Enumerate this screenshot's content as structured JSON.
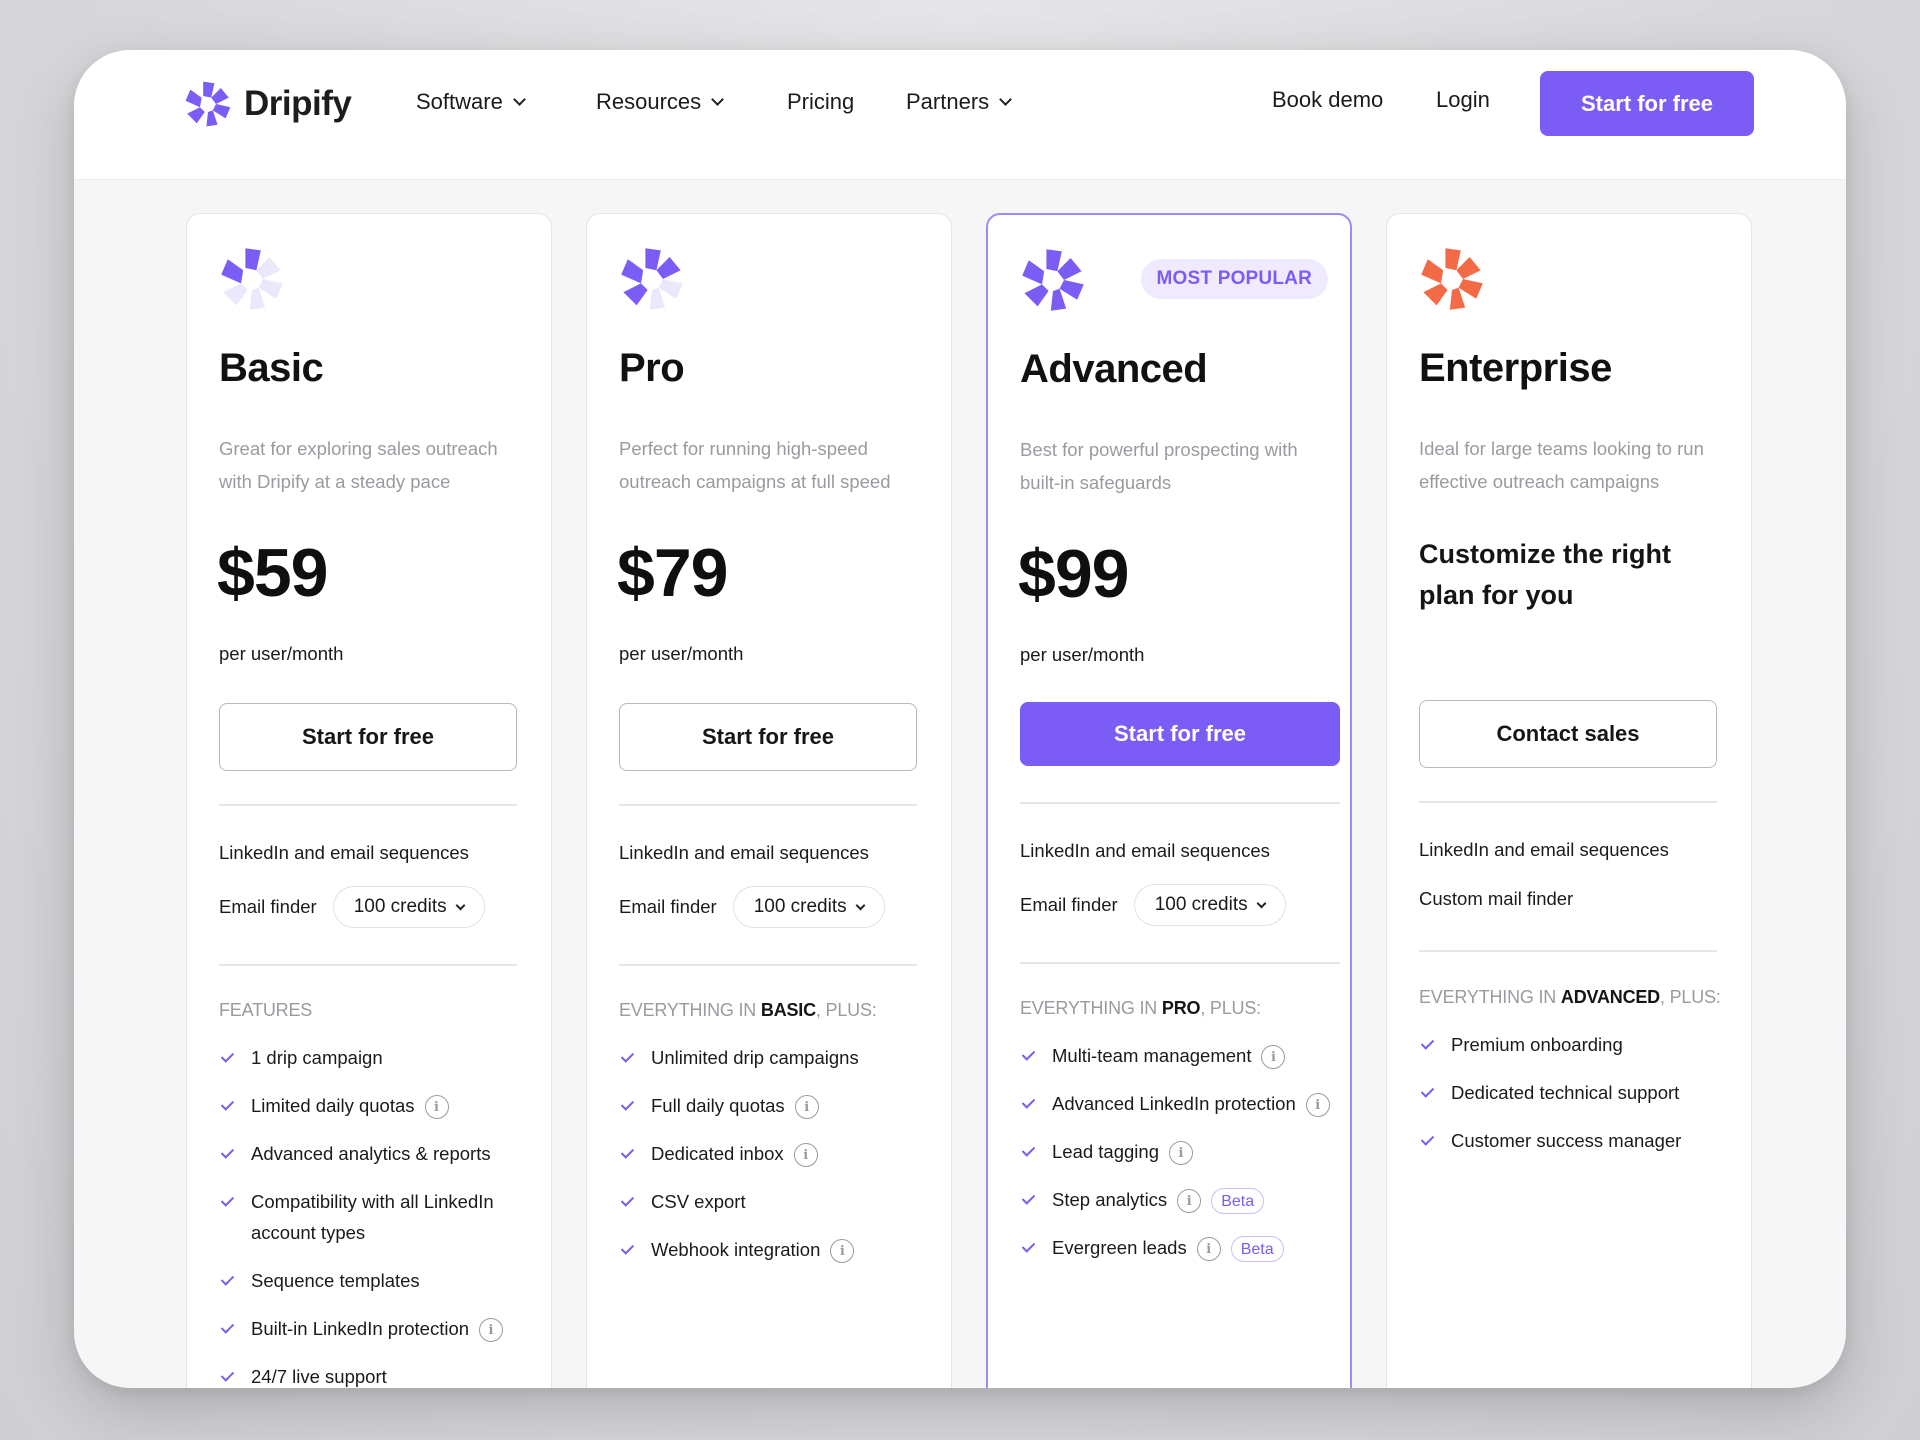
{
  "brand": {
    "name": "Dripify",
    "accent": "#7b5cf5",
    "enterprise_accent": "#f26a46"
  },
  "nav": {
    "software": "Software",
    "resources": "Resources",
    "pricing": "Pricing",
    "partners": "Partners",
    "book_demo": "Book demo",
    "login": "Login",
    "cta": "Start for free"
  },
  "plans": [
    {
      "name": "Basic",
      "desc": "Great for exploring sales outreach with Dripify at a steady pace",
      "price": "$59",
      "per": "per user/month",
      "button": "Start for free",
      "line1": "LinkedIn and email sequences",
      "finder_label": "Email finder",
      "credits": "100 credits",
      "section": {
        "prefix": "FEATURES",
        "bold": "",
        "suffix": ""
      },
      "features": [
        {
          "text": "1 drip campaign",
          "info": false
        },
        {
          "text": "Limited daily quotas",
          "info": true
        },
        {
          "text": "Advanced analytics & reports",
          "info": false
        },
        {
          "text": "Compatibility with all LinkedIn account types",
          "info": false
        },
        {
          "text": "Sequence templates",
          "info": false
        },
        {
          "text": "Built-in LinkedIn protection",
          "info": true
        },
        {
          "text": "24/7 live support",
          "info": false
        }
      ]
    },
    {
      "name": "Pro",
      "desc": "Perfect for running high-speed outreach campaigns at full speed",
      "price": "$79",
      "per": "per user/month",
      "button": "Start for free",
      "line1": "LinkedIn and email sequences",
      "finder_label": "Email finder",
      "credits": "100 credits",
      "section": {
        "prefix": "EVERYTHING IN ",
        "bold": "BASIC",
        "suffix": ", PLUS:"
      },
      "features": [
        {
          "text": "Unlimited drip campaigns",
          "info": false
        },
        {
          "text": "Full daily quotas",
          "info": true
        },
        {
          "text": "Dedicated inbox",
          "info": true
        },
        {
          "text": "CSV export",
          "info": false
        },
        {
          "text": "Webhook integration",
          "info": true
        }
      ]
    },
    {
      "name": "Advanced",
      "badge": "MOST POPULAR",
      "desc": "Best for powerful prospecting with built-in safeguards",
      "price": "$99",
      "per": "per user/month",
      "button": "Start for free",
      "line1": "LinkedIn and email sequences",
      "finder_label": "Email finder",
      "credits": "100 credits",
      "section": {
        "prefix": "EVERYTHING IN ",
        "bold": "PRO",
        "suffix": ", PLUS:"
      },
      "features": [
        {
          "text": "Multi-team management",
          "info": true
        },
        {
          "text": "Advanced LinkedIn protection",
          "info": true
        },
        {
          "text": "Lead tagging",
          "info": true
        },
        {
          "text": "Step analytics",
          "info": true,
          "beta": "Beta"
        },
        {
          "text": "Evergreen leads",
          "info": true,
          "beta": "Beta"
        }
      ]
    },
    {
      "name": "Enterprise",
      "desc": "Ideal for large teams looking to run effective outreach campaigns",
      "custom": "Customize the right plan for you",
      "button": "Contact sales",
      "line1": "LinkedIn and email sequences",
      "line2": "Custom mail finder",
      "section": {
        "prefix": "EVERYTHING IN ",
        "bold": "ADVANCED",
        "suffix": ", PLUS:"
      },
      "features": [
        {
          "text": "Premium onboarding",
          "info": false
        },
        {
          "text": "Dedicated technical support",
          "info": false
        },
        {
          "text": "Customer success manager",
          "info": false
        }
      ]
    }
  ]
}
